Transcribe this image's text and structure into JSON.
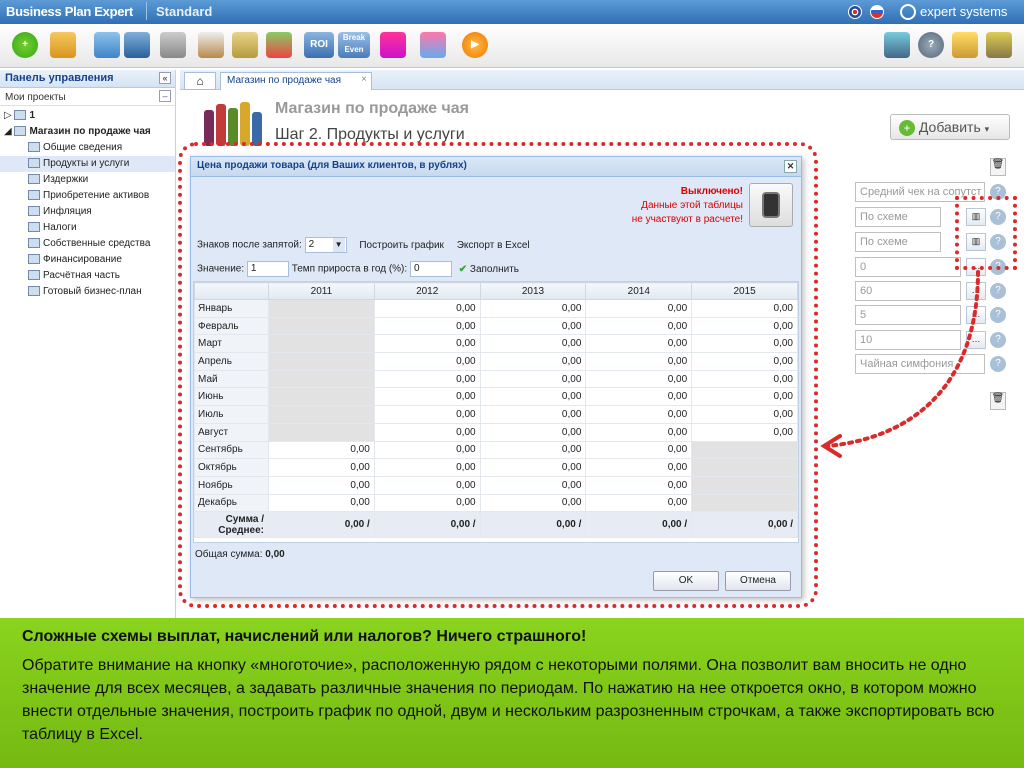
{
  "app": {
    "name": "Business Plan Expert",
    "edition": "Standard",
    "brand": "expert systems"
  },
  "sidebar": {
    "title": "Панель управления",
    "collapse": "«",
    "projects_label": "Мои проекты",
    "projects_collapse": "–",
    "tree": [
      {
        "label": "1",
        "level": 0
      },
      {
        "label": "Магазин по продаже чая",
        "level": 0
      },
      {
        "label": "Общие сведения",
        "level": 1
      },
      {
        "label": "Продукты и услуги",
        "level": 1
      },
      {
        "label": "Издержки",
        "level": 1
      },
      {
        "label": "Приобретение активов",
        "level": 1
      },
      {
        "label": "Инфляция",
        "level": 1
      },
      {
        "label": "Налоги",
        "level": 1
      },
      {
        "label": "Собственные средства",
        "level": 1
      },
      {
        "label": "Финансирование",
        "level": 1
      },
      {
        "label": "Расчётная часть",
        "level": 1
      },
      {
        "label": "Готовый бизнес-план",
        "level": 1
      }
    ]
  },
  "tabs": {
    "project_tab": "Магазин по продаже чая"
  },
  "page": {
    "title": "Магазин по продаже чая",
    "step": "Шаг 2. Продукты и услуги",
    "add_button": "Добавить"
  },
  "side_fields": [
    "Средний чек на сопутст",
    "По схеме",
    "По схеме",
    "0",
    "60",
    "5",
    "10",
    "Чайная симфония"
  ],
  "dialog": {
    "title": "Цена продажи товара (для Ваших клиентов, в рублях)",
    "status_title": "Выключено!",
    "status_line1": "Данные этой таблицы",
    "status_line2": "не участвуют в расчете!",
    "decimals_label": "Знаков после запятой:",
    "decimals_value": "2",
    "build_chart": "Построить график",
    "export_excel": "Экспорт в Excel",
    "value_label": "Значение:",
    "value": "1",
    "growth_label": "Темп прироста в  год (%):",
    "growth_value": "0",
    "fill": "Заполнить",
    "years": [
      "2011",
      "2012",
      "2013",
      "2014",
      "2015"
    ],
    "months": [
      "Январь",
      "Февраль",
      "Март",
      "Апрель",
      "Май",
      "Июнь",
      "Июль",
      "Август",
      "Сентябрь",
      "Октябрь",
      "Ноябрь",
      "Декабрь"
    ],
    "cells": [
      [
        "",
        "0,00",
        "0,00",
        "0,00",
        "0,00"
      ],
      [
        "",
        "0,00",
        "0,00",
        "0,00",
        "0,00"
      ],
      [
        "",
        "0,00",
        "0,00",
        "0,00",
        "0,00"
      ],
      [
        "",
        "0,00",
        "0,00",
        "0,00",
        "0,00"
      ],
      [
        "",
        "0,00",
        "0,00",
        "0,00",
        "0,00"
      ],
      [
        "",
        "0,00",
        "0,00",
        "0,00",
        "0,00"
      ],
      [
        "",
        "0,00",
        "0,00",
        "0,00",
        "0,00"
      ],
      [
        "",
        "0,00",
        "0,00",
        "0,00",
        "0,00"
      ],
      [
        "0,00",
        "0,00",
        "0,00",
        "0,00",
        ""
      ],
      [
        "0,00",
        "0,00",
        "0,00",
        "0,00",
        ""
      ],
      [
        "0,00",
        "0,00",
        "0,00",
        "0,00",
        ""
      ],
      [
        "0,00",
        "0,00",
        "0,00",
        "0,00",
        ""
      ]
    ],
    "sum_label": "Сумма / Среднее:",
    "sums": [
      "0,00 /",
      "0,00 /",
      "0,00 /",
      "0,00 /",
      "0,00 /"
    ],
    "grand_total_label": "Общая сумма:",
    "grand_total": "0,00",
    "ok": "OK",
    "cancel": "Отмена"
  },
  "callout": {
    "title": "Сложные схемы выплат, начислений или налогов? Ничего страшного!",
    "text": "Обратите внимание  на кнопку  «многоточие», расположенную рядом с некоторыми полями.  Она позволит вам вносить не одно значение для всех месяцев, а задавать различные значения по периодам. По нажатию на нее откроется окно, в котором можно внести отдельные значения, построить график по одной, двум и нескольким разрозненным строчкам, а также экспортировать всю таблицу  в Excel."
  }
}
